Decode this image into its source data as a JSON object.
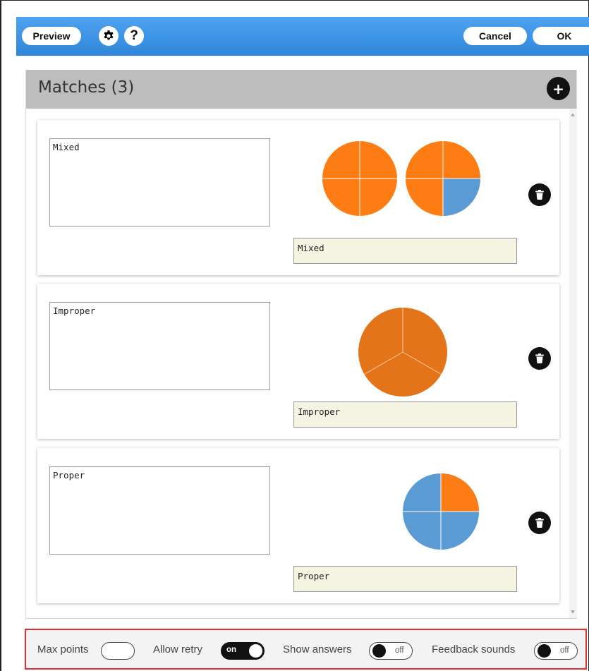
{
  "toolbar": {
    "preview_label": "Preview",
    "gear_icon": "gear-icon",
    "help_label": "?",
    "cancel_label": "Cancel",
    "ok_label": "OK",
    "bar_color": "#3a92e4"
  },
  "panel": {
    "title": "Matches (3)",
    "add_label": "+"
  },
  "matches": [
    {
      "text": "Mixed",
      "answer": "Mixed",
      "image": "two circles divided in fourths: 4/4 orange and 3/4 orange (1 and 3/4)"
    },
    {
      "text": "Improper",
      "answer": "Improper",
      "image": "circle divided in thirds, all shaded orange"
    },
    {
      "text": "Proper",
      "answer": "Proper",
      "image": "circle divided in fourths, 1/4 orange"
    }
  ],
  "footer": {
    "max_points_label": "Max points",
    "allow_retry_label": "Allow retry",
    "allow_retry_state": "on",
    "show_answers_label": "Show answers",
    "show_answers_state": "off",
    "feedback_sounds_label": "Feedback sounds",
    "feedback_sounds_state": "off"
  },
  "colors": {
    "orange": "#fd7d14",
    "dark_orange": "#e47419",
    "blue": "#5b9bd5",
    "answer_bg": "#f5f3e1",
    "highlight_border": "#e03030"
  }
}
